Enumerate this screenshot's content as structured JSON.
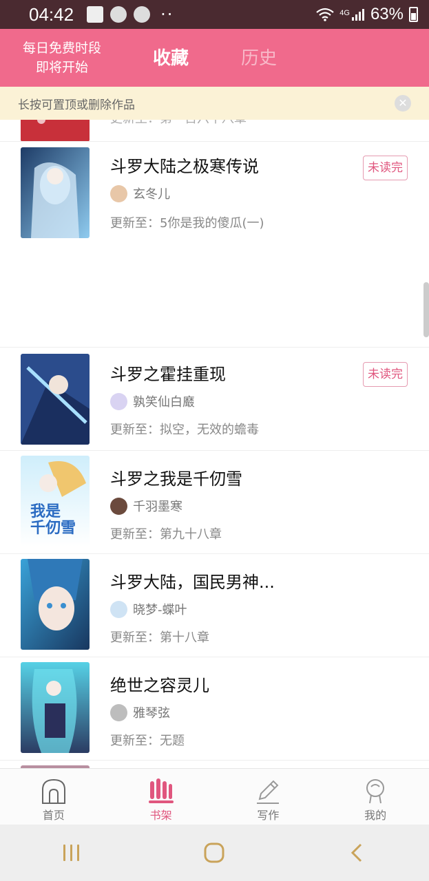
{
  "status_bar": {
    "time": "04:42",
    "network": "4G",
    "battery": "63%"
  },
  "header": {
    "promo_line1": "每日免费时段",
    "promo_line2": "即将开始",
    "tabs": [
      {
        "label": "收藏",
        "active": true
      },
      {
        "label": "历史",
        "active": false
      }
    ]
  },
  "tip": {
    "text": "长按可置顶或删除作品"
  },
  "partial_top": {
    "update": "更新至：第一百六十八章"
  },
  "books": [
    {
      "title": "斗罗大陆之极寒传说",
      "author": "玄冬儿",
      "update": "更新至：5你是我的傻瓜(一)",
      "badge": "未读完"
    },
    {
      "title": "斗罗之霍挂重现",
      "author": "孰笑仙白黀",
      "update": "更新至：拟空，无效的蟾毒",
      "badge": "未读完"
    },
    {
      "title": "斗罗之我是千仞雪",
      "author": "千羽墨寒",
      "update": "更新至：第九十八章",
      "badge": ""
    },
    {
      "title": "斗罗大陆，国民男神...",
      "author": "晓梦-蝶叶",
      "update": "更新至：第十八章",
      "badge": ""
    },
    {
      "title": "绝世之容灵儿",
      "author": "雅琴弦",
      "update": "更新至：无题",
      "badge": ""
    }
  ],
  "cover_text": {
    "book3_line1": "我是",
    "book3_line2": "千仞雪"
  },
  "bottom_nav": [
    {
      "label": "首页",
      "icon": "home-icon",
      "active": false
    },
    {
      "label": "书架",
      "icon": "bookshelf-icon",
      "active": true
    },
    {
      "label": "写作",
      "icon": "pencil-icon",
      "active": false
    },
    {
      "label": "我的",
      "icon": "profile-icon",
      "active": false
    }
  ],
  "colors": {
    "brand": "#f06a8c",
    "accent": "#e0567e",
    "status_bar": "#4a2a30",
    "tip_bg": "#fbf2d6"
  }
}
